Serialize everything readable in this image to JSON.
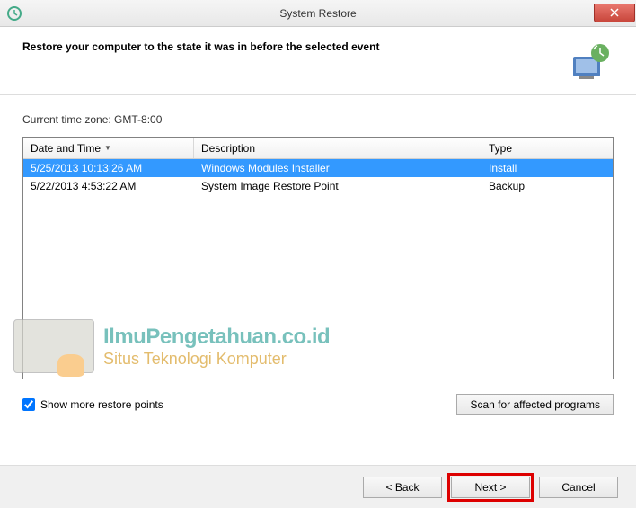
{
  "window": {
    "title": "System Restore"
  },
  "header": {
    "text": "Restore your computer to the state it was in before the selected event"
  },
  "timezone": "Current time zone: GMT-8:00",
  "table": {
    "columns": {
      "date": "Date and Time",
      "desc": "Description",
      "type": "Type"
    },
    "rows": [
      {
        "date": "5/25/2013 10:13:26 AM",
        "desc": "Windows Modules Installer",
        "type": "Install",
        "selected": true
      },
      {
        "date": "5/22/2013 4:53:22 AM",
        "desc": "System Image Restore Point",
        "type": "Backup",
        "selected": false
      }
    ]
  },
  "checkbox": {
    "label": "Show more restore points",
    "checked": true
  },
  "buttons": {
    "scan": "Scan for affected programs",
    "back": "< Back",
    "next": "Next >",
    "cancel": "Cancel"
  },
  "watermark": {
    "title": "IlmuPengetahuan.co.id",
    "subtitle": "Situs Teknologi Komputer"
  }
}
